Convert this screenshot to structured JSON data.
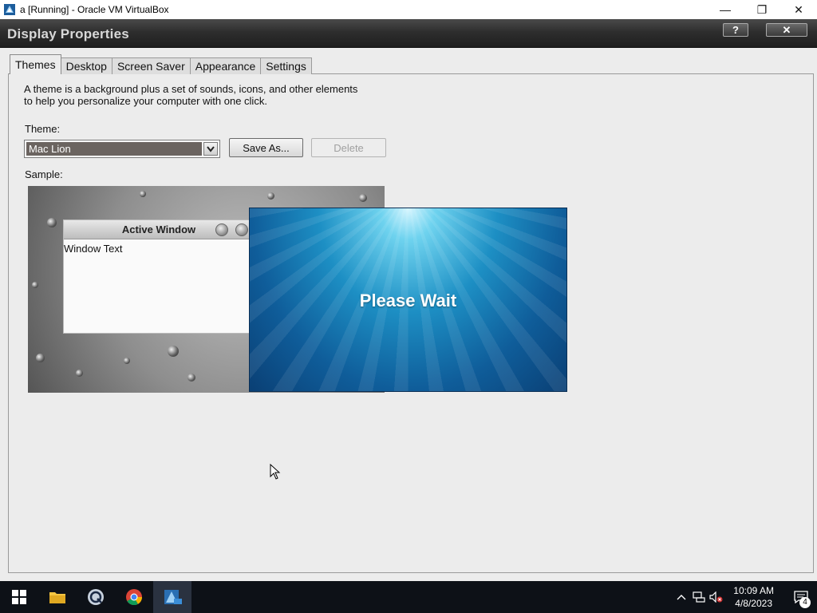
{
  "host_window": {
    "title": "a [Running] - Oracle VM VirtualBox",
    "controls": {
      "minimize": "—",
      "restore": "❐",
      "close": "✕"
    }
  },
  "dialog": {
    "title": "Display Properties",
    "help_label": "?",
    "close_label": "✕",
    "tabs": [
      {
        "label": "Themes",
        "active": true
      },
      {
        "label": "Desktop",
        "active": false
      },
      {
        "label": "Screen Saver",
        "active": false
      },
      {
        "label": "Appearance",
        "active": false
      },
      {
        "label": "Settings",
        "active": false
      }
    ],
    "themes_tab": {
      "description_line1": "A theme is a background plus a set of sounds, icons, and other elements",
      "description_line2": "to help you personalize your computer with one click.",
      "theme_label": "Theme:",
      "theme_value": "Mac Lion",
      "save_as_label": "Save As...",
      "delete_label": "Delete",
      "sample_label": "Sample:",
      "sample": {
        "active_window_title": "Active Window",
        "window_text": "Window Text"
      }
    }
  },
  "overlay": {
    "message": "Please Wait"
  },
  "taskbar": {
    "apps": [
      {
        "name": "start-button",
        "icon": "windows-logo"
      },
      {
        "name": "file-explorer",
        "icon": "folder-icon"
      },
      {
        "name": "qt-app",
        "icon": "qt-icon"
      },
      {
        "name": "chrome",
        "icon": "chrome-icon"
      },
      {
        "name": "virtualbox",
        "icon": "virtualbox-icon",
        "active": true
      }
    ],
    "clock_time": "10:09 AM",
    "clock_date": "4/8/2023",
    "notification_count": "4"
  },
  "colors": {
    "taskbar_bg": "#0d1117",
    "dialog_bg": "#ececec",
    "combo_selected": "#6b6460",
    "wait_blue": "#0f5d9a"
  }
}
